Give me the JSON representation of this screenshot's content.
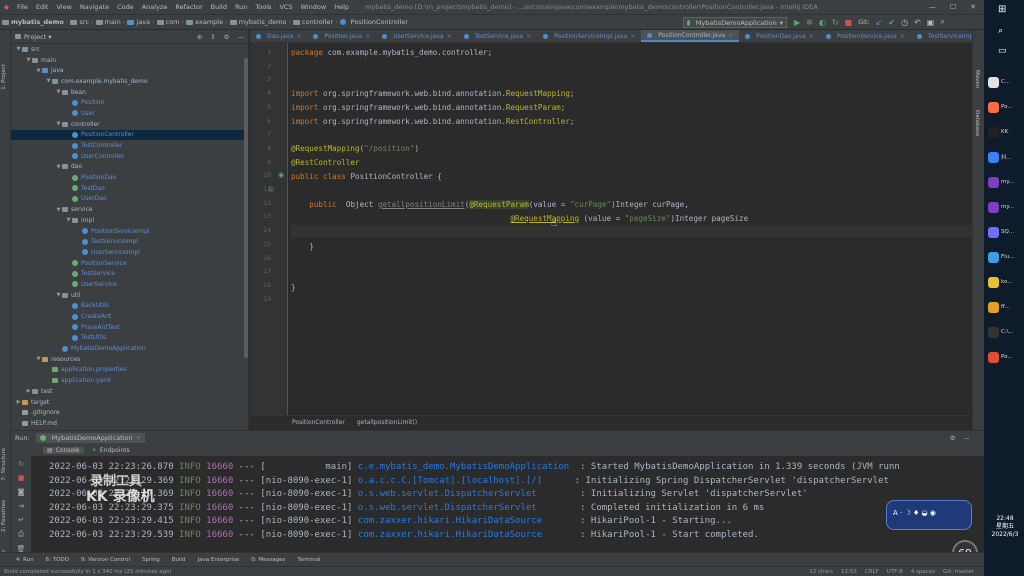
{
  "menu": {
    "items": [
      "File",
      "Edit",
      "View",
      "Navigate",
      "Code",
      "Analyze",
      "Refactor",
      "Build",
      "Run",
      "Tools",
      "VCS",
      "Window",
      "Help"
    ],
    "title": "mybatis_demo [D:\\m_project\\mybatis_demo] - ...\\src\\main\\java\\com\\example\\mybatis_demo\\controller\\PositionController.java - IntelliJ IDEA"
  },
  "nav": {
    "crumbs": [
      "mybatis_demo",
      "src",
      "main",
      "java",
      "com",
      "example",
      "mybatis_demo",
      "controller",
      "PositionController"
    ],
    "run_config": "MybatisDemoApplication",
    "git_label": "Git:"
  },
  "project": {
    "header": "Project",
    "tree": [
      {
        "indent": 0,
        "arrow": "▼",
        "icon": "folder",
        "label": "src",
        "color": "gray"
      },
      {
        "indent": 1,
        "arrow": "▼",
        "icon": "folder",
        "label": "main",
        "color": "gray"
      },
      {
        "indent": 2,
        "arrow": "▼",
        "icon": "folder-blue",
        "label": "java",
        "color": "gray"
      },
      {
        "indent": 3,
        "arrow": "▼",
        "icon": "folder",
        "label": "com.example.mybatis_demo",
        "color": "gray"
      },
      {
        "indent": 4,
        "arrow": "▼",
        "icon": "folder",
        "label": "bean",
        "color": "gray"
      },
      {
        "indent": 5,
        "arrow": "",
        "icon": "class",
        "label": "Position",
        "color": "blue"
      },
      {
        "indent": 5,
        "arrow": "",
        "icon": "class",
        "label": "User",
        "color": "blue"
      },
      {
        "indent": 4,
        "arrow": "▼",
        "icon": "folder",
        "label": "controller",
        "color": "gray"
      },
      {
        "indent": 5,
        "arrow": "",
        "icon": "class",
        "label": "PositionController",
        "color": "blue",
        "selected": true
      },
      {
        "indent": 5,
        "arrow": "",
        "icon": "class",
        "label": "TestController",
        "color": "blue"
      },
      {
        "indent": 5,
        "arrow": "",
        "icon": "class",
        "label": "UserController",
        "color": "blue"
      },
      {
        "indent": 4,
        "arrow": "▼",
        "icon": "folder",
        "label": "dao",
        "color": "gray"
      },
      {
        "indent": 5,
        "arrow": "",
        "icon": "iface",
        "label": "PositionDao",
        "color": "blue"
      },
      {
        "indent": 5,
        "arrow": "",
        "icon": "iface",
        "label": "TestDao",
        "color": "blue"
      },
      {
        "indent": 5,
        "arrow": "",
        "icon": "iface",
        "label": "UserDao",
        "color": "blue"
      },
      {
        "indent": 4,
        "arrow": "▼",
        "icon": "folder",
        "label": "service",
        "color": "gray"
      },
      {
        "indent": 5,
        "arrow": "▼",
        "icon": "folder",
        "label": "impl",
        "color": "gray"
      },
      {
        "indent": 6,
        "arrow": "",
        "icon": "class",
        "label": "PositionServiceImpl",
        "color": "blue"
      },
      {
        "indent": 6,
        "arrow": "",
        "icon": "class",
        "label": "TestServiceImpl",
        "color": "blue"
      },
      {
        "indent": 6,
        "arrow": "",
        "icon": "class",
        "label": "UserServiceImpl",
        "color": "blue"
      },
      {
        "indent": 5,
        "arrow": "",
        "icon": "iface",
        "label": "PositionService",
        "color": "blue"
      },
      {
        "indent": 5,
        "arrow": "",
        "icon": "iface",
        "label": "TestService",
        "color": "blue"
      },
      {
        "indent": 5,
        "arrow": "",
        "icon": "iface",
        "label": "UserService",
        "color": "blue"
      },
      {
        "indent": 4,
        "arrow": "▼",
        "icon": "folder",
        "label": "util",
        "color": "gray"
      },
      {
        "indent": 5,
        "arrow": "",
        "icon": "class",
        "label": "BackUtils",
        "color": "blue"
      },
      {
        "indent": 5,
        "arrow": "",
        "icon": "class",
        "label": "CreateAnt",
        "color": "blue"
      },
      {
        "indent": 5,
        "arrow": "",
        "icon": "class",
        "label": "PraseAntTest",
        "color": "blue"
      },
      {
        "indent": 5,
        "arrow": "",
        "icon": "class",
        "label": "TestUtils",
        "color": "blue"
      },
      {
        "indent": 4,
        "arrow": "",
        "icon": "class",
        "label": "MybatisDemoApplication",
        "color": "blue"
      },
      {
        "indent": 2,
        "arrow": "▼",
        "icon": "folder-res",
        "label": "resources",
        "color": "gray"
      },
      {
        "indent": 3,
        "arrow": "",
        "icon": "props",
        "label": "application.properties",
        "color": "blue"
      },
      {
        "indent": 3,
        "arrow": "",
        "icon": "props",
        "label": "application.yaml",
        "color": "blue"
      },
      {
        "indent": 1,
        "arrow": "▶",
        "icon": "folder",
        "label": "test",
        "color": "gray"
      },
      {
        "indent": 0,
        "arrow": "▶",
        "icon": "folder-orange",
        "label": "target",
        "color": "gray"
      },
      {
        "indent": 0,
        "arrow": "",
        "icon": "file",
        "label": ".gitignore",
        "color": "gray"
      },
      {
        "indent": 0,
        "arrow": "",
        "icon": "file",
        "label": "HELP.md",
        "color": "gray"
      }
    ]
  },
  "editor": {
    "tabs": [
      {
        "label": "Dao.java"
      },
      {
        "label": "Position.java"
      },
      {
        "label": "UserService.java"
      },
      {
        "label": "TestService.java"
      },
      {
        "label": "PositionServiceImpl.java"
      },
      {
        "label": "PositionController.java",
        "active": true
      },
      {
        "label": "PositionDao.java"
      },
      {
        "label": "PositionService.java"
      },
      {
        "label": "TestServiceImpl.java"
      }
    ],
    "line_numbers": [
      "1",
      "2",
      "3",
      "4",
      "5",
      "6",
      "7",
      "8",
      "9",
      "10",
      "11",
      "12",
      "13",
      "14",
      "15",
      "16",
      "17",
      "18",
      "19"
    ],
    "code": {
      "l1_kw": "package ",
      "l1_rest": "com.example.mybatis_demo.controller;",
      "l4_kw": "import ",
      "l4_pkg": "org.springframework.web.bind.annotation.",
      "l4_cls": "RequestMapping",
      "l4_end": ";",
      "l5_kw": "import ",
      "l5_pkg": "org.springframework.web.bind.annotation.",
      "l5_cls": "RequestParam",
      "l5_end": ";",
      "l6_kw": "import ",
      "l6_pkg": "org.springframework.web.bind.annotation.",
      "l6_cls": "RestController",
      "l6_end": ";",
      "l8_an": "@RequestMapping",
      "l8_p1": "(",
      "l8_st": "\"/position\"",
      "l8_p2": ")",
      "l9_an": "@RestController",
      "l10_kw": "public class ",
      "l10_rest": "PositionController {",
      "l12_kw": "    public  ",
      "l12_t": "Object ",
      "l12_m": "getallpositionLimit",
      "l12_p": "(",
      "l12_an": "@RequestParam",
      "l12_a": "(value = ",
      "l12_st": "\"curPage\"",
      "l12_b": ")Integer curPage,",
      "l13_pad": "                                                ",
      "l13_an": "@RequestMapping",
      "l13_a": " (value = ",
      "l13_st": "\"pageSize\"",
      "l13_b": ")Integer pageSize",
      "l15": "    }",
      "l18": "}"
    },
    "breadcrumb": [
      "PositionController",
      "getallpositionLimit()"
    ]
  },
  "run": {
    "label": "Run:",
    "config": "MybatisDemoApplication",
    "tabs": [
      "Console",
      "Endpoints"
    ],
    "lines": [
      {
        "date": "2022-06-03 22:23:26.870",
        "lvl": "INFO",
        "pid": "16660",
        "sep": "---",
        "thread": "[           main]",
        "logger": "c.e.mybatis_demo.MybatisDemoApplication ",
        "msg": ": Started MybatisDemoApplication in 1.339 seconds (JVM runn"
      },
      {
        "date": "2022-06-03 22:23:29.369",
        "lvl": "INFO",
        "pid": "16660",
        "sep": "---",
        "thread": "[nio-8090-exec-1]",
        "logger": "o.a.c.c.C.[Tomcat].[localhost].[/]     ",
        "msg": ": Initializing Spring DispatcherServlet 'dispatcherServlet"
      },
      {
        "date": "2022-06-03 22:23:29.369",
        "lvl": "INFO",
        "pid": "16660",
        "sep": "---",
        "thread": "[nio-8090-exec-1]",
        "logger": "o.s.web.servlet.DispatcherServlet       ",
        "msg": ": Initializing Servlet 'dispatcherServlet'"
      },
      {
        "date": "2022-06-03 22:23:29.375",
        "lvl": "INFO",
        "pid": "16660",
        "sep": "---",
        "thread": "[nio-8090-exec-1]",
        "logger": "o.s.web.servlet.DispatcherServlet       ",
        "msg": ": Completed initialization in 6 ms"
      },
      {
        "date": "2022-06-03 22:23:29.415",
        "lvl": "INFO",
        "pid": "16660",
        "sep": "---",
        "thread": "[nio-8090-exec-1]",
        "logger": "com.zaxxer.hikari.HikariDataSource      ",
        "msg": ": HikariPool-1 - Starting..."
      },
      {
        "date": "2022-06-03 22:23:29.539",
        "lvl": "INFO",
        "pid": "16660",
        "sep": "---",
        "thread": "[nio-8090-exec-1]",
        "logger": "com.zaxxer.hikari.HikariDataSource      ",
        "msg": ": HikariPool-1 - Start completed."
      }
    ]
  },
  "bottom_tools": [
    "4: Run",
    "6: TODO",
    "9: Version Control",
    "Spring",
    "Build",
    "Java Enterprise",
    "0: Messages",
    "Terminal"
  ],
  "status": {
    "left": "Build completed successfully in 1 s 340 ms (25 minutes ago)",
    "right": [
      "12 chars",
      "12:53",
      "CRLF",
      "UTF-8",
      "4 spaces",
      "Git: master"
    ]
  },
  "watermark": {
    "line1": "录制工具",
    "line2": "KK 录像机"
  },
  "percent": "69",
  "taskbar": {
    "items": [
      "C...",
      "Po...",
      "KK",
      "抖...",
      "my...",
      "my...",
      "SQ...",
      "Flu...",
      "ko...",
      "ff...",
      "C:\\...",
      "Po..."
    ],
    "time": "22:48",
    "day": "星期五",
    "date": "2022/6/3"
  },
  "colors": {
    "bg": "#2b2b2b",
    "panel": "#3c3f41",
    "keyword": "#cc7832",
    "annotation": "#bbb529",
    "string": "#6a8759",
    "accent": "#4a88c7"
  }
}
